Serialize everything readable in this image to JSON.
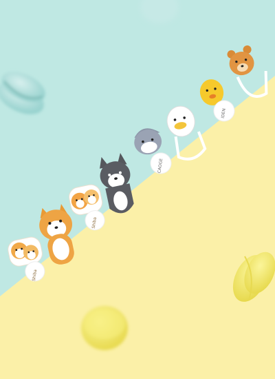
{
  "photo": {
    "background_colors": {
      "mint": "#bfe8e3",
      "yellow": "#fbf0a8"
    },
    "props": [
      {
        "name": "macaron",
        "color": "#a9d9d6"
      },
      {
        "name": "macaron",
        "color": "#f2e86a"
      }
    ],
    "bookmarks": [
      {
        "character": "shiba-pair",
        "label": "Shiba"
      },
      {
        "character": "shiba-dog",
        "label": ""
      },
      {
        "character": "shiba-pup",
        "label": "Shiba"
      },
      {
        "character": "husky-dog",
        "label": ""
      },
      {
        "character": "shark",
        "label": "CAOGE"
      },
      {
        "character": "white-duck",
        "label": ""
      },
      {
        "character": "yellow-chick",
        "label": "IDEN"
      },
      {
        "character": "brown-bear",
        "label": ""
      }
    ]
  }
}
